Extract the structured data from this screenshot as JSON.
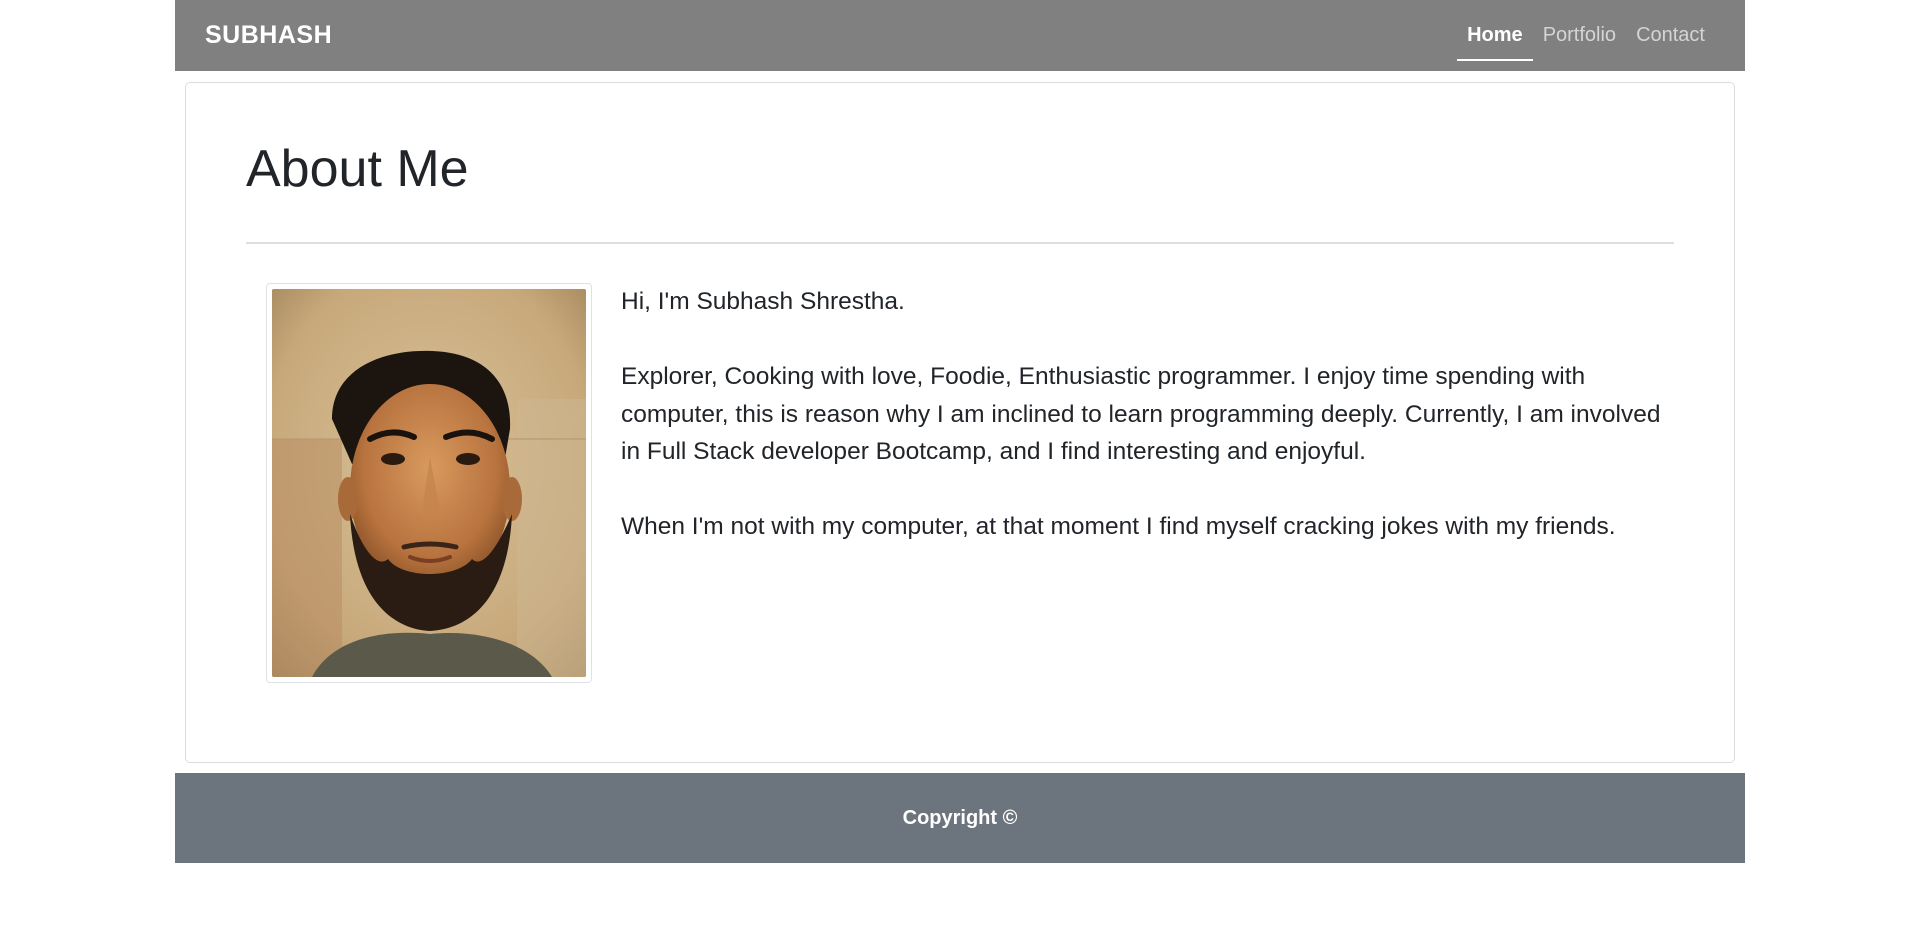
{
  "navbar": {
    "brand": "SUBHASH",
    "links": [
      {
        "label": "Home",
        "active": true
      },
      {
        "label": "Portfolio",
        "active": false
      },
      {
        "label": "Contact",
        "active": false
      }
    ]
  },
  "about": {
    "title": "About Me",
    "photo_icon": "profile-photo",
    "paragraphs": [
      "Hi, I'm Subhash Shrestha.",
      "Explorer, Cooking with love, Foodie, Enthusiastic programmer. I enjoy time spending with computer, this is reason why I am inclined to learn programming deeply. Currently, I am involved in Full Stack developer Bootcamp, and I find interesting and enjoyful.",
      "When I'm not with my computer, at that moment I find myself cracking jokes with my friends."
    ]
  },
  "footer": {
    "text": "Copyright ©"
  },
  "colors": {
    "navbar_bg": "#808080",
    "footer_bg": "#6c757d",
    "text": "#212529"
  }
}
